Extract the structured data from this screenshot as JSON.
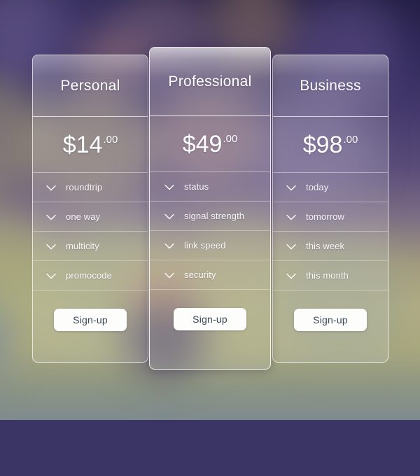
{
  "background": {
    "description": "blurred photographic gradient",
    "top_color": "#241f46",
    "mid_color": "#7d6f84",
    "bottom_color": "#a9a87e"
  },
  "theme": {
    "card_border": "#ffffff",
    "text_color": "#ffffff",
    "button_bg": "#fdfdfb",
    "button_text": "#38475a"
  },
  "plans": [
    {
      "id": "personal",
      "name": "Personal",
      "currency": "$",
      "amount": "14",
      "cents": ".00",
      "featured": false,
      "features": [
        {
          "icon": "check-icon",
          "label": "roundtrip"
        },
        {
          "icon": "check-icon",
          "label": "one way"
        },
        {
          "icon": "check-icon",
          "label": "multicity"
        },
        {
          "icon": "check-icon",
          "label": "promocode"
        }
      ],
      "cta": "Sign-up"
    },
    {
      "id": "professional",
      "name": "Professional",
      "currency": "$",
      "amount": "49",
      "cents": ".00",
      "featured": true,
      "features": [
        {
          "icon": "check-icon",
          "label": "status"
        },
        {
          "icon": "check-icon",
          "label": "signal strength"
        },
        {
          "icon": "check-icon",
          "label": "link speed"
        },
        {
          "icon": "check-icon",
          "label": "security"
        }
      ],
      "cta": "Sign-up"
    },
    {
      "id": "business",
      "name": "Business",
      "currency": "$",
      "amount": "98",
      "cents": ".00",
      "featured": false,
      "features": [
        {
          "icon": "check-icon",
          "label": "today"
        },
        {
          "icon": "check-icon",
          "label": "tomorrow"
        },
        {
          "icon": "check-icon",
          "label": "this week"
        },
        {
          "icon": "check-icon",
          "label": "this month"
        }
      ],
      "cta": "Sign-up"
    }
  ]
}
